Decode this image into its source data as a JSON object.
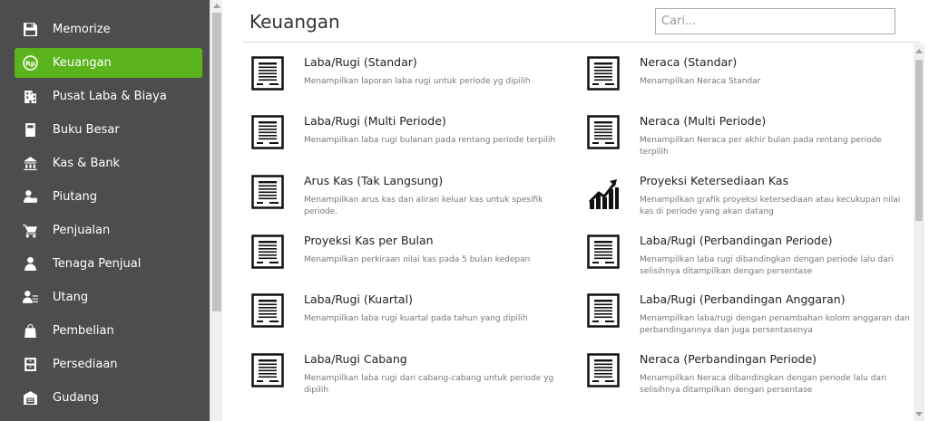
{
  "sidebar": {
    "items": [
      {
        "label": "Memorize",
        "icon": "save-icon",
        "active": false
      },
      {
        "label": "Keuangan",
        "icon": "rupiah-icon",
        "active": true
      },
      {
        "label": "Pusat Laba & Biaya",
        "icon": "building-icon",
        "active": false
      },
      {
        "label": "Buku Besar",
        "icon": "book-icon",
        "active": false
      },
      {
        "label": "Kas & Bank",
        "icon": "bank-icon",
        "active": false
      },
      {
        "label": "Piutang",
        "icon": "receivable-icon",
        "active": false
      },
      {
        "label": "Penjualan",
        "icon": "cart-icon",
        "active": false
      },
      {
        "label": "Tenaga Penjual",
        "icon": "salesperson-icon",
        "active": false
      },
      {
        "label": "Utang",
        "icon": "payable-icon",
        "active": false
      },
      {
        "label": "Pembelian",
        "icon": "shopping-bag-icon",
        "active": false
      },
      {
        "label": "Persediaan",
        "icon": "inventory-icon",
        "active": false
      },
      {
        "label": "Gudang",
        "icon": "warehouse-icon",
        "active": false
      }
    ]
  },
  "main": {
    "title": "Keuangan",
    "search": {
      "placeholder": "Cari...",
      "value": ""
    },
    "reports": [
      {
        "title": "Laba/Rugi (Standar)",
        "desc": "Menampilkan laporan laba rugi untuk periode yg dipilih",
        "icon": "document-icon"
      },
      {
        "title": "Neraca (Standar)",
        "desc": "Menampilkan Neraca Standar",
        "icon": "document-icon"
      },
      {
        "title": "Laba/Rugi (Multi Periode)",
        "desc": "Menampilkan laba rugi bulanan pada rentang periode terpilih",
        "icon": "document-icon"
      },
      {
        "title": "Neraca (Multi Periode)",
        "desc": "Menampilkan Neraca per akhir bulan pada rentang periode terpilih",
        "icon": "document-icon"
      },
      {
        "title": "Arus Kas (Tak Langsung)",
        "desc": "Menampilkan arus kas dan aliran keluar kas untuk spesifik periode.",
        "icon": "document-icon"
      },
      {
        "title": "Proyeksi Ketersediaan Kas",
        "desc": "Menampilkan grafik proyeksi ketersediaan atau kecukupan nilai kas di periode yang akan datang",
        "icon": "growth-chart-icon"
      },
      {
        "title": "Proyeksi Kas per Bulan",
        "desc": "Menampilkan perkiraan nilai kas pada 5 bulan kedepan",
        "icon": "document-icon"
      },
      {
        "title": "Laba/Rugi (Perbandingan Periode)",
        "desc": "Menampilkan laba rugi dibandingkan dengan periode lalu dari selisihnya ditampilkan dengan persentase",
        "icon": "document-icon"
      },
      {
        "title": "Laba/Rugi (Kuartal)",
        "desc": "Menampilkan laba rugi kuartal pada tahun yang dipilih",
        "icon": "document-icon"
      },
      {
        "title": "Laba/Rugi (Perbandingan Anggaran)",
        "desc": "Menampilkan laba/rugi dengan penambahan kolom anggaran dan perbandingannya dan juga persentasenya",
        "icon": "document-icon"
      },
      {
        "title": "Laba/Rugi Cabang",
        "desc": "Menampilkan laba rugi dari cabang-cabang untuk periode yg dipilih",
        "icon": "document-icon"
      },
      {
        "title": "Neraca (Perbandingan Periode)",
        "desc": "Menampilkan Neraca dibandingkan dengan periode lalu dari selisihnya ditampilkan dengan persentase",
        "icon": "document-icon"
      }
    ]
  },
  "colors": {
    "sidebar_bg": "#4d4d4d",
    "active_bg": "#5bb31e",
    "sidebar_text": "#ffffff"
  }
}
